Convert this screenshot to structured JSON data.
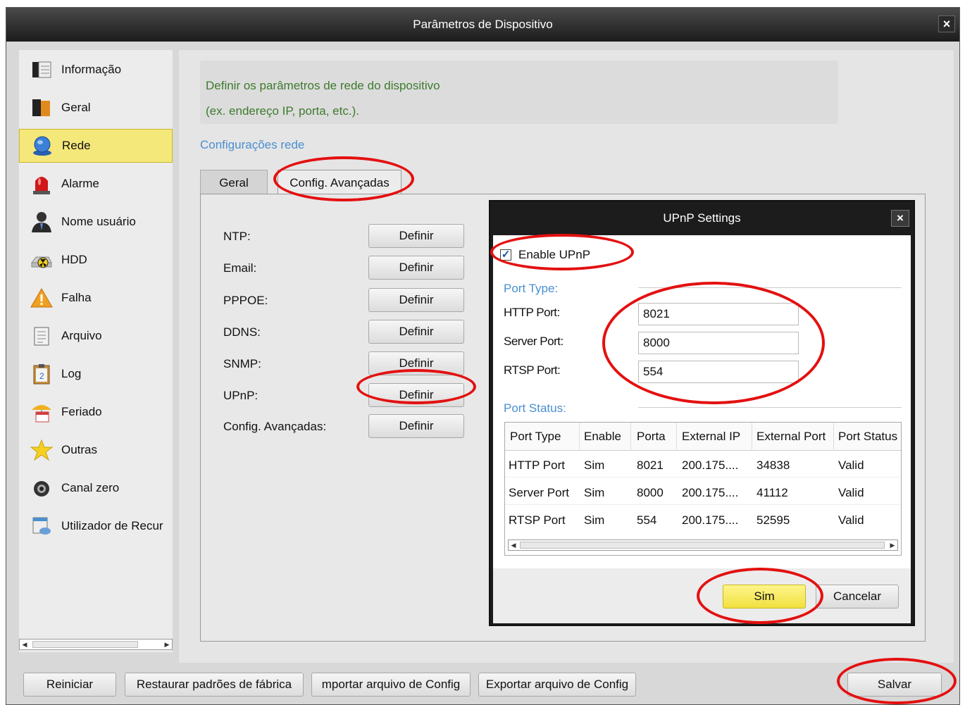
{
  "window": {
    "title": "Parâmetros de Dispositivo",
    "close": "×"
  },
  "sidebar": {
    "items": [
      {
        "label": "Informação",
        "icon": "info-book-icon"
      },
      {
        "label": "Geral",
        "icon": "general-book-icon"
      },
      {
        "label": "Rede",
        "icon": "network-globe-icon",
        "active": true
      },
      {
        "label": "Alarme",
        "icon": "alarm-siren-icon"
      },
      {
        "label": "Nome usuário",
        "icon": "user-icon"
      },
      {
        "label": "HDD",
        "icon": "hdd-hazard-icon"
      },
      {
        "label": "Falha",
        "icon": "warning-triangle-icon"
      },
      {
        "label": "Arquivo",
        "icon": "file-icon"
      },
      {
        "label": "Log",
        "icon": "log-clipboard-icon"
      },
      {
        "label": "Feriado",
        "icon": "holiday-calendar-icon"
      },
      {
        "label": "Outras",
        "icon": "star-icon"
      },
      {
        "label": "Canal zero",
        "icon": "camera-icon"
      },
      {
        "label": "Utilizador de Recur",
        "icon": "resource-icon"
      }
    ]
  },
  "main": {
    "banner_line1": "Definir os parâmetros de rede do dispositivo",
    "banner_line2": "(ex. endereço IP, porta, etc.).",
    "section_title": "Configurações rede",
    "tabs": [
      {
        "label": "Geral"
      },
      {
        "label": "Config. Avançadas",
        "active": true
      }
    ],
    "rows": [
      {
        "label": "NTP:",
        "button": "Definir"
      },
      {
        "label": "Email:",
        "button": "Definir"
      },
      {
        "label": "PPPOE:",
        "button": "Definir"
      },
      {
        "label": "DDNS:",
        "button": "Definir"
      },
      {
        "label": "SNMP:",
        "button": "Definir"
      },
      {
        "label": "UPnP:",
        "button": "Definir"
      },
      {
        "label": "Config. Avançadas:",
        "button": "Definir"
      }
    ]
  },
  "dialog": {
    "title": "UPnP Settings",
    "close": "×",
    "enable_label": "Enable UPnP",
    "enable_checked": true,
    "port_type_label": "Port Type:",
    "ports": [
      {
        "label": "HTTP Port:",
        "value": "8021"
      },
      {
        "label": "Server Port:",
        "value": "8000"
      },
      {
        "label": "RTSP Port:",
        "value": "554"
      }
    ],
    "port_status_label": "Port Status:",
    "table": {
      "headers": [
        "Port Type",
        "Enable",
        "Porta",
        "External IP",
        "External Port",
        "Port Status"
      ],
      "rows": [
        [
          "HTTP Port",
          "Sim",
          "8021",
          "200.175....",
          "34838",
          "Valid"
        ],
        [
          "Server Port",
          "Sim",
          "8000",
          "200.175....",
          "41112",
          "Valid"
        ],
        [
          "RTSP Port",
          "Sim",
          "554",
          "200.175....",
          "52595",
          "Valid"
        ]
      ]
    },
    "ok_label": "Sim",
    "cancel_label": "Cancelar"
  },
  "footer": {
    "buttons": [
      "Reiniciar",
      "Restaurar padrões de fábrica",
      "mportar arquivo de Config",
      "Exportar arquivo de Config"
    ],
    "save": "Salvar"
  },
  "colors": {
    "annotation": "#e41010",
    "active_item": "#f5e87a",
    "banner_text": "#3e7a2e",
    "link_blue": "#4a8fd0"
  }
}
